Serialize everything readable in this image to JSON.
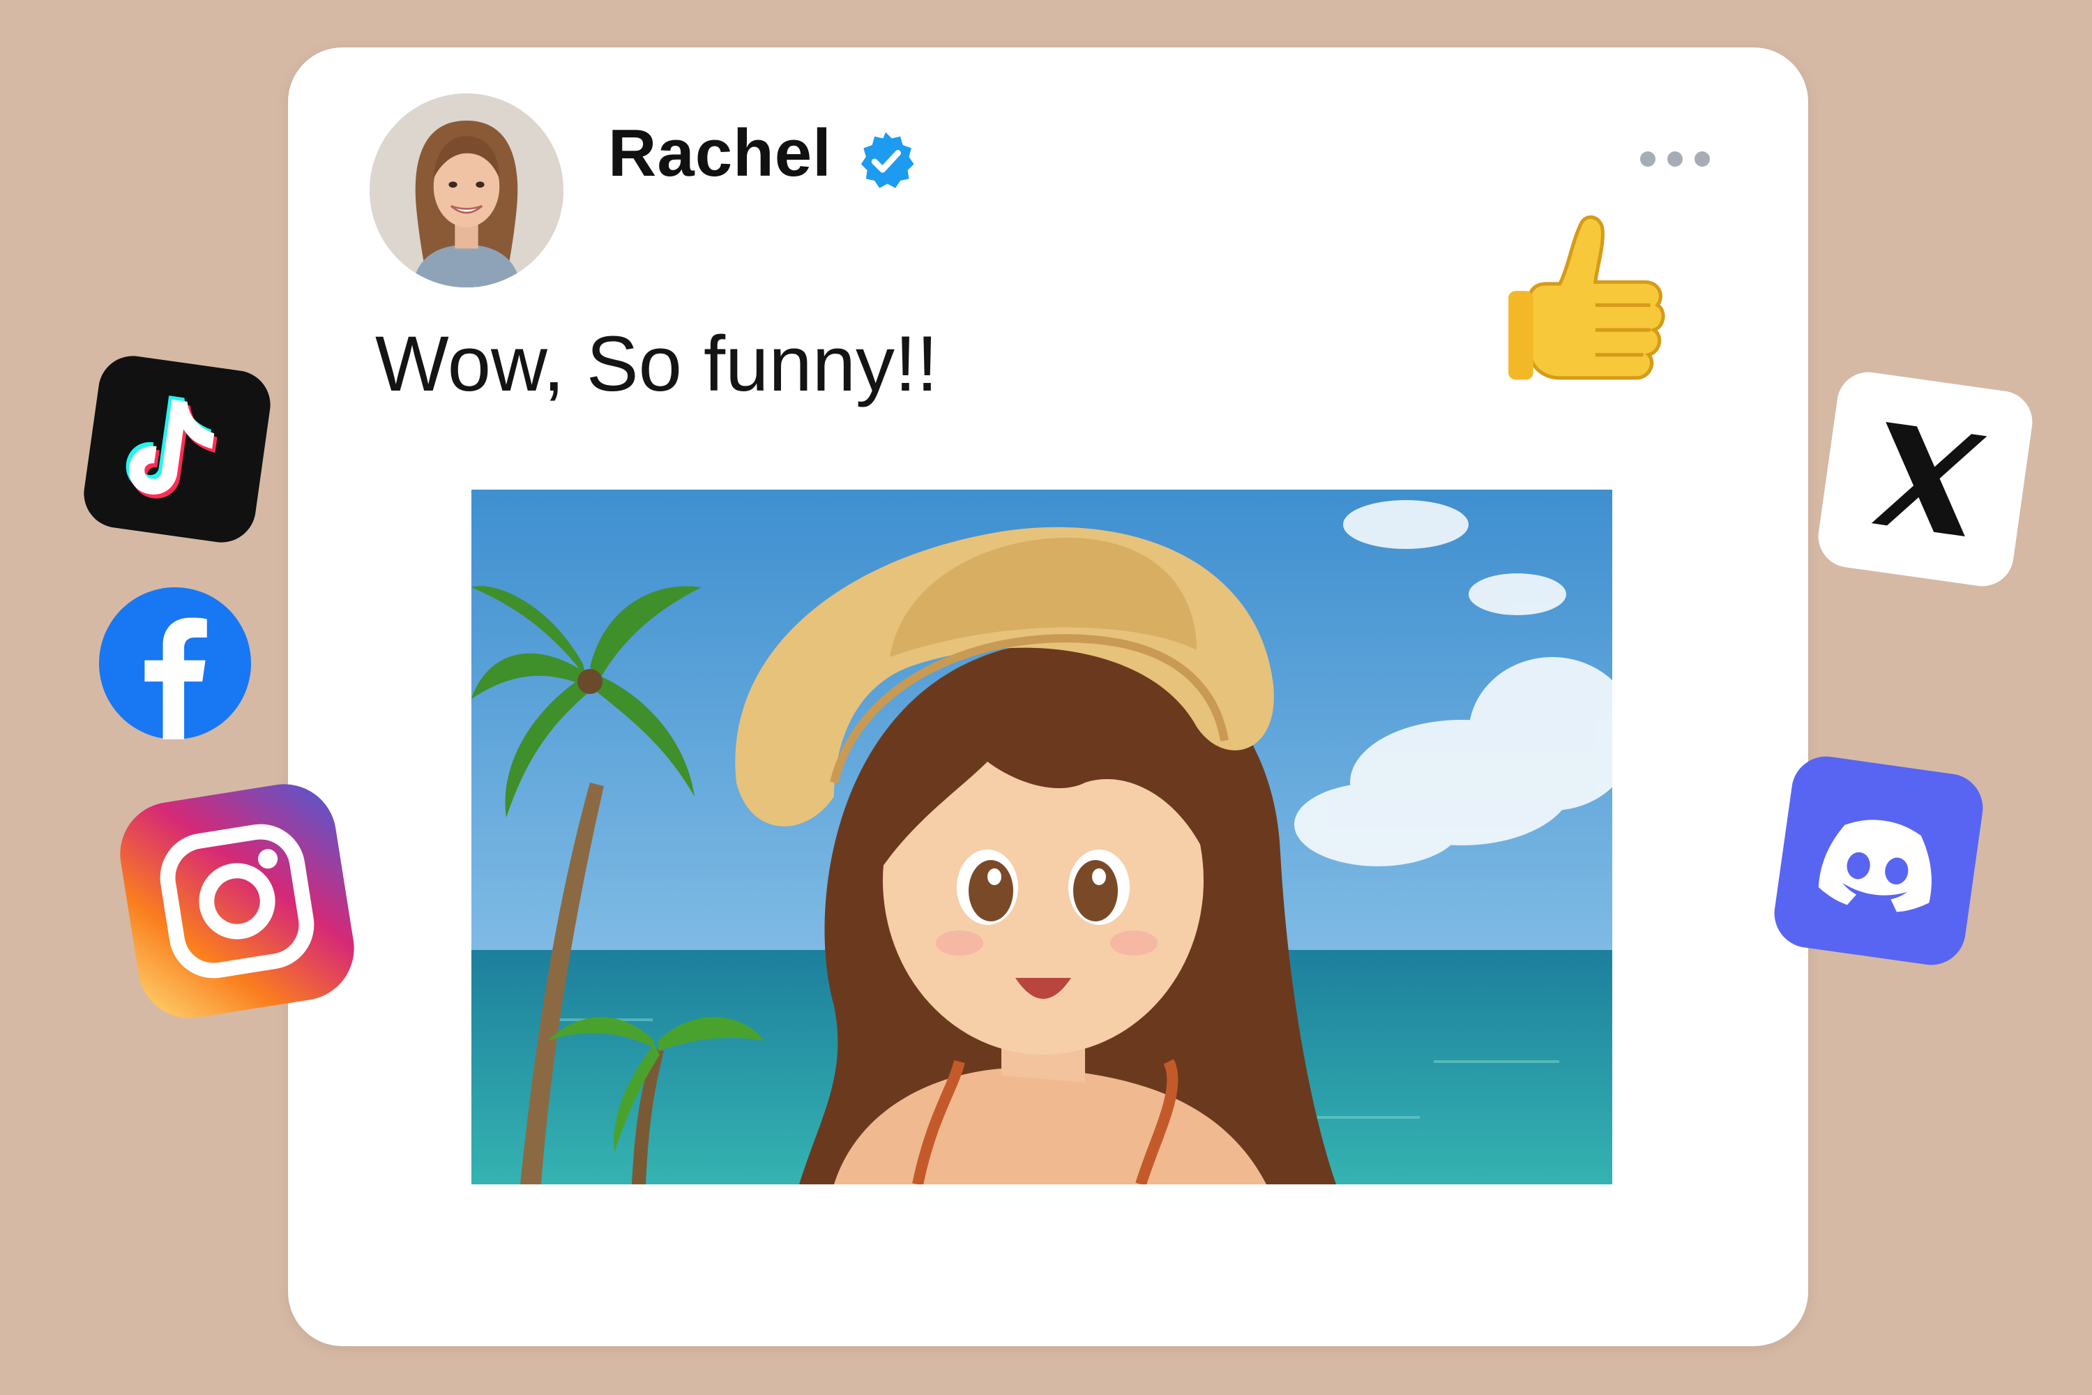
{
  "post": {
    "username": "Rachel",
    "text": "Wow, So funny!!",
    "verified": true
  },
  "icons": {
    "verified_badge": "verified-check-icon",
    "more_options": "more-options-icon",
    "reaction": "thumbs-up-icon",
    "avatar": "profile-photo",
    "post_image": "anime-girl-beach-illustration"
  },
  "social_apps": [
    "tiktok",
    "facebook",
    "instagram",
    "x",
    "discord"
  ],
  "colors": {
    "background": "#d5b9a5",
    "card": "#ffffff",
    "verified": "#1d9bf0",
    "facebook": "#1877f2",
    "discord": "#5865f2"
  }
}
